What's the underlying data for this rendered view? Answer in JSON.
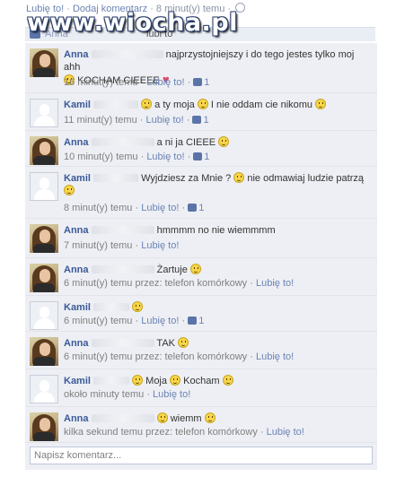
{
  "header": {
    "like_label": "Lubię to!",
    "comment_label": "Dodaj komentarz",
    "time": "8 minut(y) temu",
    "watermark": "www.wiocha.pl",
    "likes_text": "Anna",
    "likes_text_tail": "lubi to"
  },
  "comments": [
    {
      "author": "Anna",
      "text_a": "najprzystojniejszy i do tego jestes tylko moj ahh",
      "text_b": "KOCHAM CIEEEE",
      "time": "16 minut(y) temu",
      "like": "Lubię to!",
      "likes": "1"
    },
    {
      "author": "Kamil",
      "text_a": "a ty moja",
      "text_b": "I nie oddam cie nikomu",
      "time": "11 minut(y) temu",
      "like": "Lubię to!",
      "likes": "1"
    },
    {
      "author": "Anna",
      "text_a": "a ni ja CIEEE",
      "time": "10 minut(y) temu",
      "like": "Lubię to!",
      "likes": "1"
    },
    {
      "author": "Kamil",
      "text_a": "Wyjdziesz za Mnie ?",
      "text_b": "nie odmawiaj ludzie patrzą",
      "time": "8 minut(y) temu",
      "like": "Lubię to!",
      "likes": "1"
    },
    {
      "author": "Anna",
      "text_a": "hmmmm no nie wiemmmm",
      "time": "7 minut(y) temu",
      "like": "Lubię to!"
    },
    {
      "author": "Anna",
      "text_a": "Żartuje",
      "time": "6 minut(y) temu przez: telefon komórkowy",
      "like": "Lubię to!"
    },
    {
      "author": "Kamil",
      "time": "6 minut(y) temu",
      "like": "Lubię to!",
      "likes": "1"
    },
    {
      "author": "Anna",
      "text_a": "TAK",
      "time": "6 minut(y) temu przez: telefon komórkowy",
      "like": "Lubię to!"
    },
    {
      "author": "Kamil",
      "text_a": "Moja",
      "text_b": "Kocham",
      "time": "około minuty temu",
      "like": "Lubię to!"
    },
    {
      "author": "Anna",
      "text_a": "wiemm",
      "time": "kilka sekund temu przez: telefon komórkowy",
      "like": "Lubię to!"
    }
  ],
  "input": {
    "placeholder": "Napisz komentarz..."
  }
}
